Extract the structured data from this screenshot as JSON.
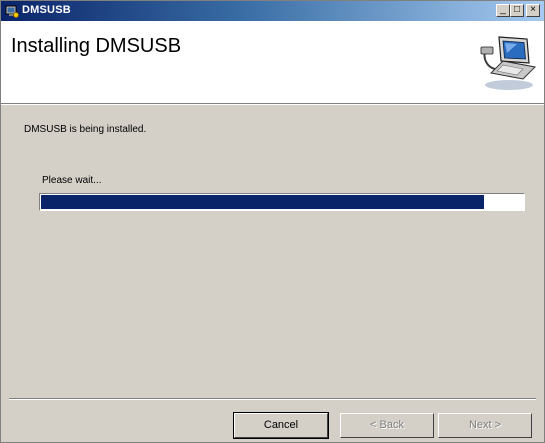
{
  "window": {
    "title": "DMSUSB",
    "controls": {
      "minimize": "_",
      "maximize": "□",
      "close": "×"
    }
  },
  "banner": {
    "title": "Installing DMSUSB",
    "graphic_icon": "computer-install-icon"
  },
  "main": {
    "status_text": "DMSUSB is being installed.",
    "wait_text": "Please wait...",
    "progress_fraction": 0.92
  },
  "footer": {
    "cancel_label": "Cancel",
    "back_label": "< Back",
    "next_label": "Next >"
  },
  "colors": {
    "title_start": "#0a246a",
    "title_end": "#a6caf0",
    "progress_fill": "#0a246a",
    "window_bg": "#d4d0c8"
  }
}
